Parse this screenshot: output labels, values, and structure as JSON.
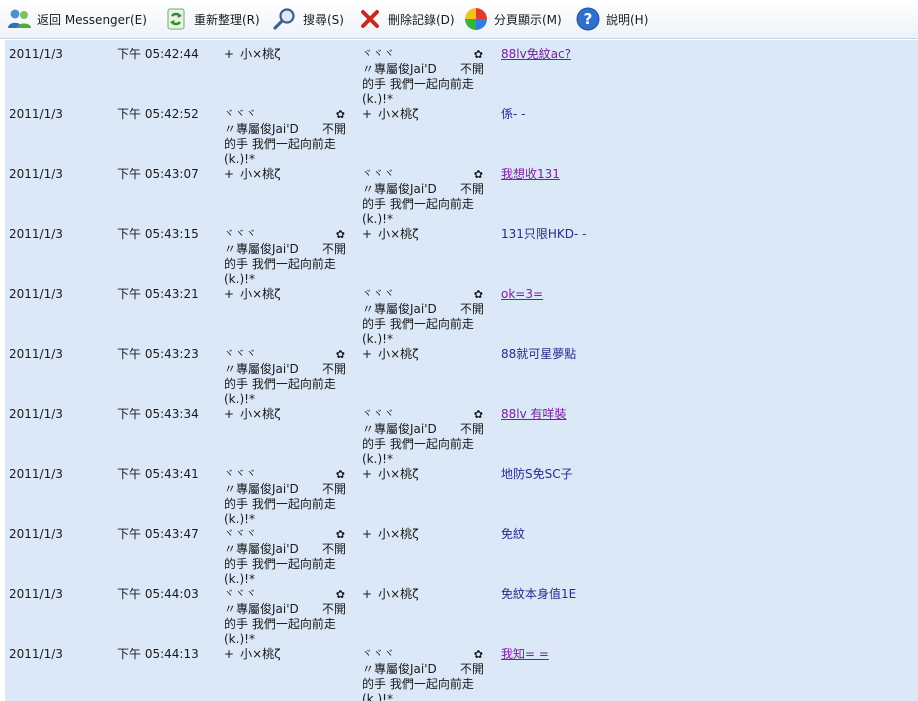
{
  "toolbar": {
    "back": "返回 Messenger(E)",
    "refresh": "重新整理(R)",
    "search": "搜尋(S)",
    "delete": "刪除記錄(D)",
    "paged": "分頁顯示(M)",
    "help": "說明(H)"
  },
  "nicks": {
    "a": {
      "pre": "+",
      "name": "小×桃ζ"
    },
    "b": {
      "l1": "ヾヾヾ",
      "flower": "✿",
      "l2_left": "〃專屬俊Jai'D",
      "l2_right": "不開",
      "l3": "的手 我們一起向前走",
      "l4": "(k.)!*"
    }
  },
  "messages": [
    {
      "date": "2011/1/3",
      "time": "下午 05:42:44",
      "from": "a",
      "to": "b",
      "text": "88lv免紋ac?",
      "link": true
    },
    {
      "date": "2011/1/3",
      "time": "下午 05:42:52",
      "from": "b",
      "to": "a",
      "text": "係- -",
      "link": false
    },
    {
      "date": "2011/1/3",
      "time": "下午 05:43:07",
      "from": "a",
      "to": "b",
      "text": "我想收131",
      "link": true
    },
    {
      "date": "2011/1/3",
      "time": "下午 05:43:15",
      "from": "b",
      "to": "a",
      "text": "131只限HKD- -",
      "link": false
    },
    {
      "date": "2011/1/3",
      "time": "下午 05:43:21",
      "from": "a",
      "to": "b",
      "text": "ok=3=",
      "link": true
    },
    {
      "date": "2011/1/3",
      "time": "下午 05:43:23",
      "from": "b",
      "to": "a",
      "text": "88就可星夢點",
      "link": false
    },
    {
      "date": "2011/1/3",
      "time": "下午 05:43:34",
      "from": "a",
      "to": "b",
      "text": "88lv 有咩裝",
      "link": true
    },
    {
      "date": "2011/1/3",
      "time": "下午 05:43:41",
      "from": "b",
      "to": "a",
      "text": "地防S免SC子",
      "link": false
    },
    {
      "date": "2011/1/3",
      "time": "下午 05:43:47",
      "from": "b",
      "to": "a",
      "text": "免紋",
      "link": false
    },
    {
      "date": "2011/1/3",
      "time": "下午 05:44:03",
      "from": "b",
      "to": "a",
      "text": "免紋本身值1E",
      "link": false
    },
    {
      "date": "2011/1/3",
      "time": "下午 05:44:13",
      "from": "a",
      "to": "b",
      "text": "我知= =",
      "link": true
    }
  ]
}
